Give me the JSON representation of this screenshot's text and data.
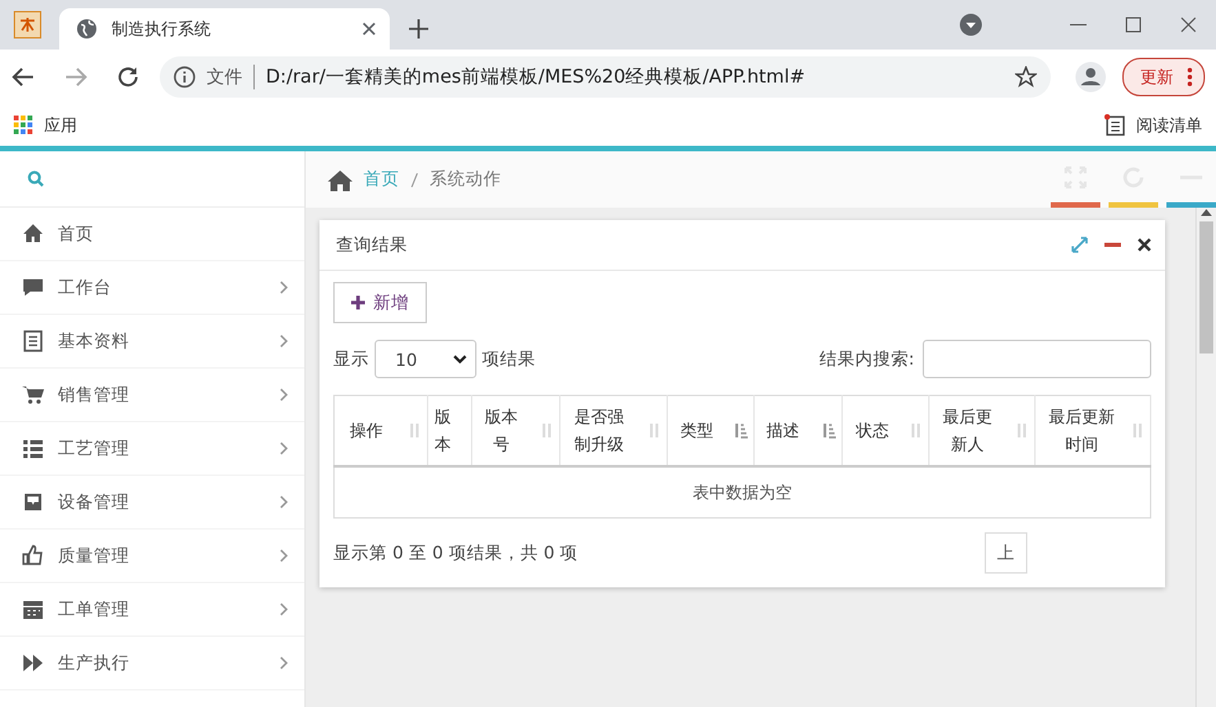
{
  "browser": {
    "tab_title": "制造执行系统",
    "address_scheme": "文件",
    "url": "D:/rar/一套精美的mes前端模板/MES%20经典模板/APP.html#",
    "update_button": "更新",
    "bookmarks": [
      "应用"
    ],
    "reading_list": "阅读清单"
  },
  "sidebar": {
    "items": [
      {
        "label": "首页",
        "expandable": false
      },
      {
        "label": "工作台",
        "expandable": true
      },
      {
        "label": "基本资料",
        "expandable": true
      },
      {
        "label": "销售管理",
        "expandable": true
      },
      {
        "label": "工艺管理",
        "expandable": true
      },
      {
        "label": "设备管理",
        "expandable": true
      },
      {
        "label": "质量管理",
        "expandable": true
      },
      {
        "label": "工单管理",
        "expandable": true
      },
      {
        "label": "生产执行",
        "expandable": true
      }
    ]
  },
  "breadcrumb": [
    {
      "label": "首页",
      "link": true
    },
    {
      "label": "系统动作",
      "link": false
    }
  ],
  "panel": {
    "title": "查询结果",
    "add_button": "新增",
    "length_label_before": "显示",
    "length_value": "10",
    "length_label_after": "项结果",
    "search_label": "结果内搜索:",
    "columns": [
      {
        "label": "操作",
        "kind": "sortable"
      },
      {
        "label": "版本",
        "kind": "plain"
      },
      {
        "label": "版本号",
        "kind": "sortable"
      },
      {
        "label": "是否强制升级",
        "kind": "sortable"
      },
      {
        "label": "类型",
        "kind": "sorted"
      },
      {
        "label": "描述",
        "kind": "sorted"
      },
      {
        "label": "状态",
        "kind": "sortable"
      },
      {
        "label": "最后更新人",
        "kind": "sortable"
      },
      {
        "label": "最后更新时间",
        "kind": "sortable"
      }
    ],
    "empty_message": "表中数据为空",
    "info": "显示第 0 至 0 项结果，共 0 项",
    "pager_button": "上"
  }
}
